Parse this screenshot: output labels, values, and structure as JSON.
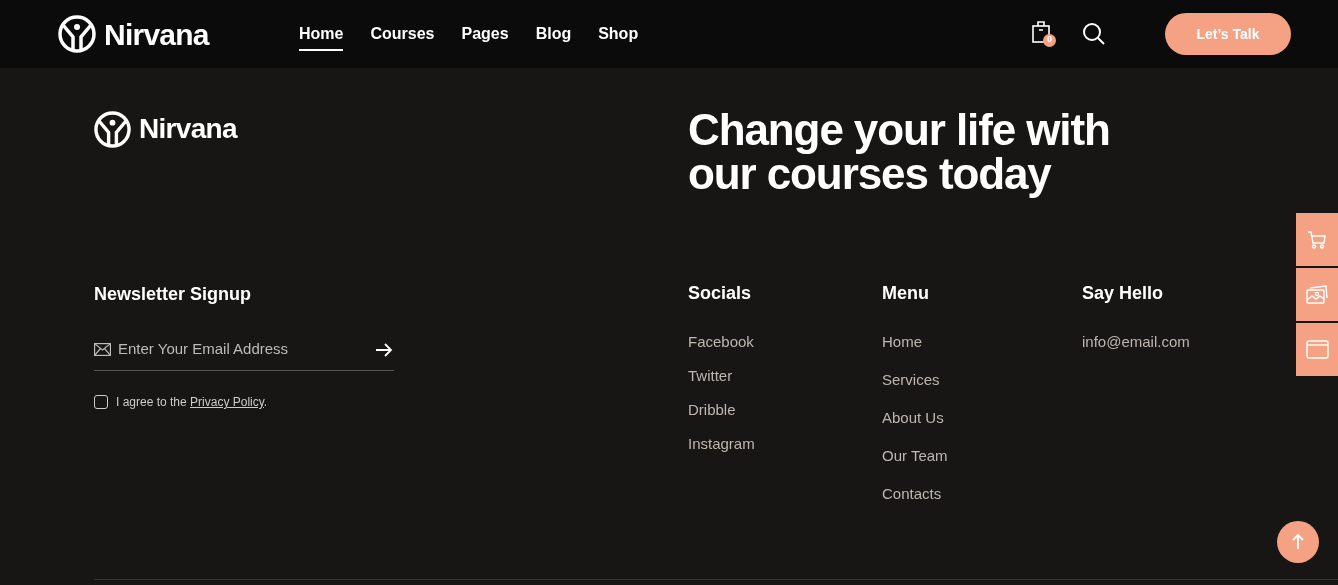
{
  "header": {
    "logo": "Nirvana",
    "nav": [
      {
        "label": "Home",
        "selected": true
      },
      {
        "label": "Courses",
        "selected": false
      },
      {
        "label": "Pages",
        "selected": false
      },
      {
        "label": "Blog",
        "selected": false
      },
      {
        "label": "Shop",
        "selected": false
      }
    ],
    "cart_count": "0",
    "cta": "Let’s Talk"
  },
  "footer": {
    "logo": "Nirvana",
    "headline": "Change your life with our courses today",
    "newsletter": {
      "title": "Newsletter Signup",
      "placeholder": "Enter Your Email Address",
      "agree_text": "I agree to the ",
      "agree_link": "Privacy Policy",
      "agree_end": ".",
      "checked": false
    },
    "columns": [
      {
        "title": "Socials",
        "links": [
          "Facebook",
          "Twitter",
          "Dribble",
          "Instagram"
        ]
      },
      {
        "title": "Menu",
        "links": [
          "Home",
          "Services",
          "About Us",
          "Our Team",
          "Contacts"
        ]
      },
      {
        "title": "Say Hello",
        "links": [
          "info@email.com"
        ]
      }
    ]
  }
}
